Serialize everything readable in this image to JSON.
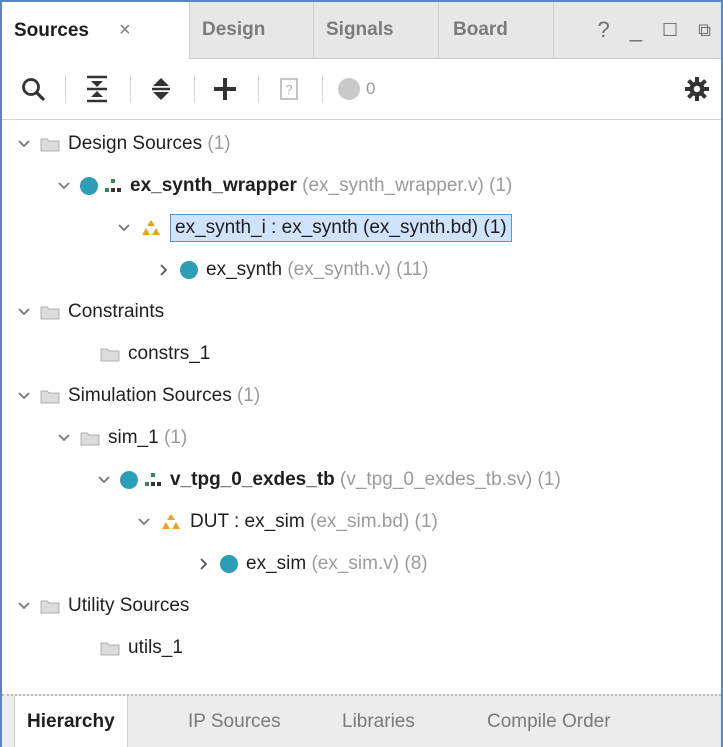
{
  "tabs": {
    "sources": "Sources",
    "close_glyph": "×",
    "design": "Design",
    "signals": "Signals",
    "board": "Board",
    "help": "?",
    "minimize": "_",
    "maximize": "☐",
    "restore": "⧉"
  },
  "toolbar": {
    "badge_count": "0"
  },
  "tree": {
    "design_sources": {
      "label": "Design Sources",
      "count": "(1)"
    },
    "wrapper": {
      "label": "ex_synth_wrapper",
      "file": "(ex_synth_wrapper.v)",
      "count": "(1)"
    },
    "synth_i": {
      "label": "ex_synth_i : ex_synth (ex_synth.bd) (1)"
    },
    "ex_synth": {
      "label": "ex_synth",
      "file": "(ex_synth.v)",
      "count": "(11)"
    },
    "constraints": {
      "label": "Constraints"
    },
    "constrs_1": {
      "label": "constrs_1"
    },
    "sim_sources": {
      "label": "Simulation Sources",
      "count": "(1)"
    },
    "sim_1": {
      "label": "sim_1",
      "count": "(1)"
    },
    "tb": {
      "label": "v_tpg_0_exdes_tb",
      "file": "(v_tpg_0_exdes_tb.sv)",
      "count": "(1)"
    },
    "dut": {
      "label": "DUT : ex_sim",
      "file": "(ex_sim.bd)",
      "count": "(1)"
    },
    "ex_sim": {
      "label": "ex_sim",
      "file": "(ex_sim.v)",
      "count": "(8)"
    },
    "utility": {
      "label": "Utility Sources"
    },
    "utils_1": {
      "label": "utils_1"
    }
  },
  "bottom_tabs": {
    "hierarchy": "Hierarchy",
    "ip_sources": "IP Sources",
    "libraries": "Libraries",
    "compile_order": "Compile Order"
  },
  "colors": {
    "accent_blue": "#2e9db8",
    "ip_orange": "#f0a020",
    "selection": "#cfe3fb"
  }
}
